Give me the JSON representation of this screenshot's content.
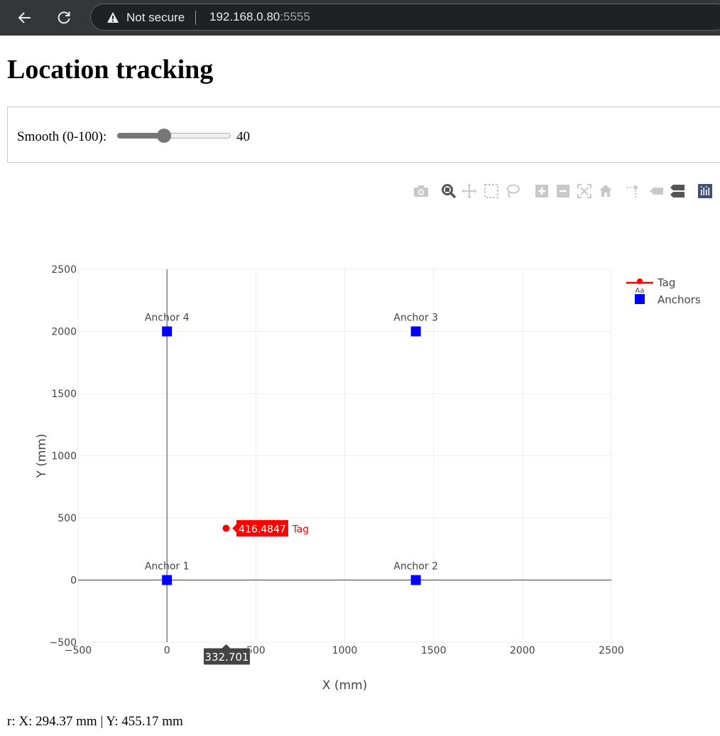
{
  "browser": {
    "security_label": "Not secure",
    "url_host": "192.168.0.80",
    "url_port": ":5555",
    "icons": [
      "back-arrow-icon",
      "reload-icon",
      "warning-icon"
    ]
  },
  "page": {
    "title": "Location tracking"
  },
  "smooth": {
    "label": "Smooth (0-100):",
    "value": "40",
    "min": 0,
    "max": 100,
    "level": 40
  },
  "modebar": {
    "icons": [
      "camera-icon",
      "zoom-icon",
      "pan-icon",
      "box-select-icon",
      "lasso-select-icon",
      "zoom-in-icon",
      "zoom-out-icon",
      "autoscale-icon",
      "reset-axes-icon",
      "spike-lines-icon",
      "hover-closest-icon",
      "hover-compare-icon",
      "plotly-logo-icon"
    ]
  },
  "chart_data": {
    "type": "scatter",
    "xlabel": "X (mm)",
    "ylabel": "Y (mm)",
    "xlim": [
      -500,
      2500
    ],
    "ylim": [
      -500,
      2500
    ],
    "x_ticks": [
      "−500",
      "0",
      "500",
      "1000",
      "1500",
      "2000",
      "2500"
    ],
    "y_ticks": [
      "−500",
      "0",
      "500",
      "1000",
      "1500",
      "2000",
      "2500"
    ],
    "grid": true,
    "legend_placement": "top-right",
    "series": [
      {
        "name": "Tag",
        "mode": "lines+markers",
        "color": "#ff0000",
        "points": [
          {
            "x": 332.701,
            "y": 416.4847
          }
        ]
      },
      {
        "name": "Anchors",
        "mode": "markers+text",
        "color": "#0000ff",
        "points": [
          {
            "x": 0,
            "y": 0,
            "label": "Anchor 1"
          },
          {
            "x": 1400,
            "y": 0,
            "label": "Anchor 2"
          },
          {
            "x": 1400,
            "y": 2000,
            "label": "Anchor 3"
          },
          {
            "x": 0,
            "y": 2000,
            "label": "Anchor 4"
          }
        ]
      }
    ],
    "hover": {
      "y_label": "416.4847",
      "trace_name": "Tag",
      "x_label": "332.701"
    },
    "legend_text_icon": "Aa"
  },
  "footer": {
    "text": "r: X: 294.37 mm | Y: 455.17 mm"
  }
}
